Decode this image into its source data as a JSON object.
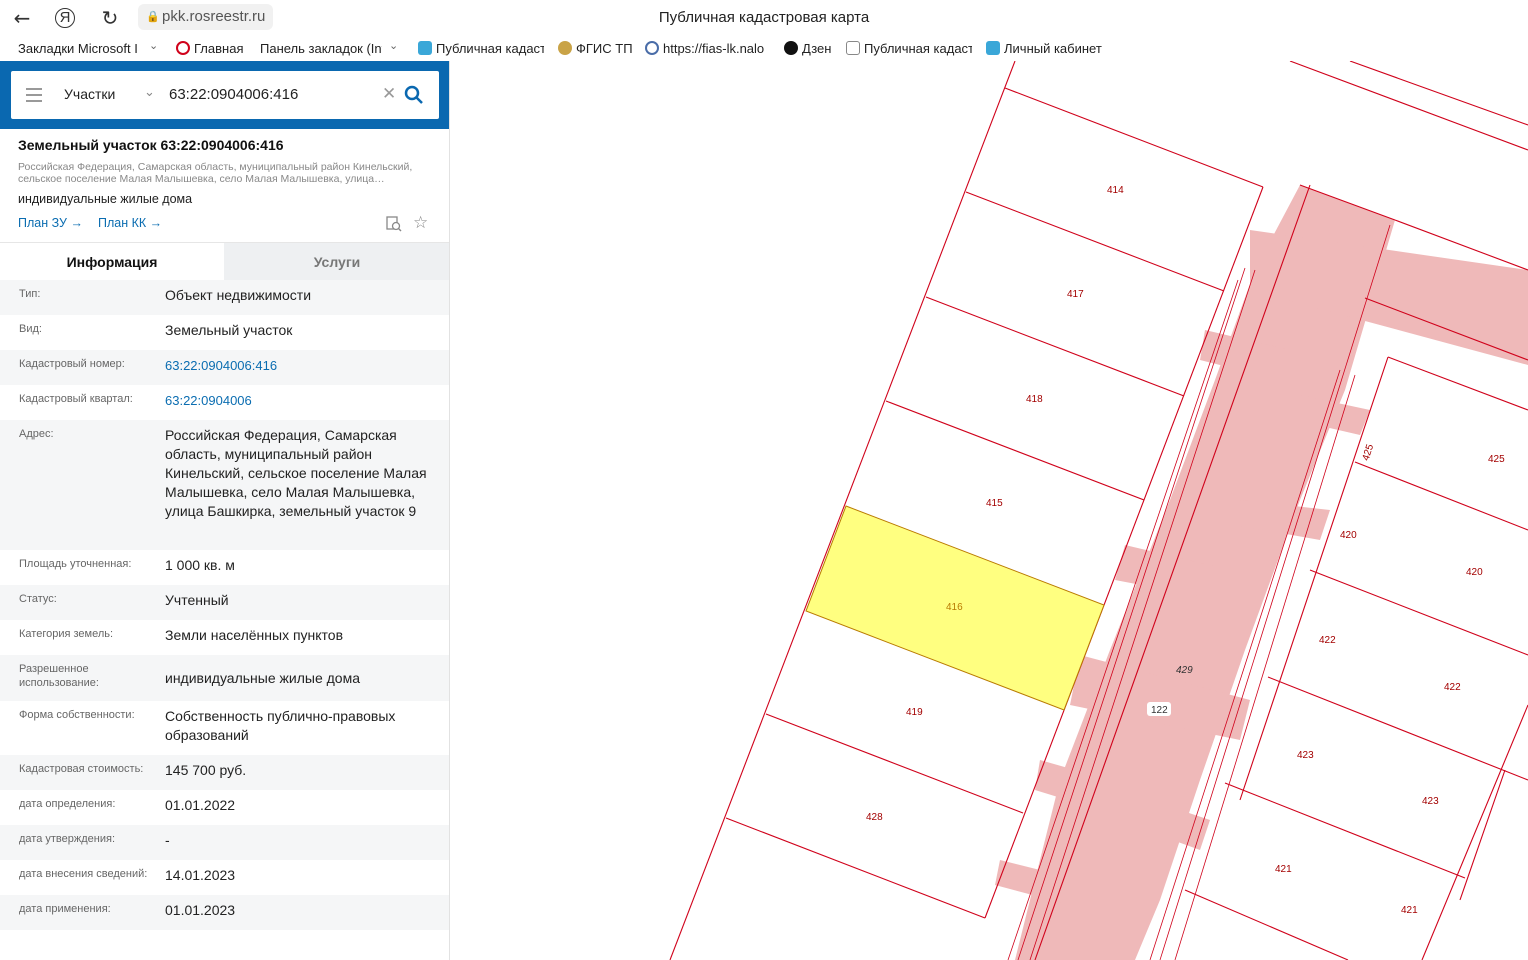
{
  "browser": {
    "url": "pkk.rosreestr.ru",
    "title": "Публичная кадастровая карта"
  },
  "bookmarks": [
    "Закладки Microsoft I",
    "Главная",
    "Панель закладок (Int",
    "Публичная кадаст",
    "ФГИС ТП",
    "https://fias-lk.nalo",
    "Дзен",
    "Публичная кадаст",
    "Личный кабинет"
  ],
  "search": {
    "type": "Участки",
    "query": "63:22:0904006:416"
  },
  "card": {
    "title": "Земельный участок 63:22:0904006:416",
    "addr1": "Российская Федерация, Самарская область, муниципальный район Кинельский,",
    "addr2": "сельское поселение Малая Малышевка, село Малая Малышевка, улица…",
    "usage": "индивидуальные жилые дома",
    "plan_zu": "План ЗУ",
    "plan_kk": "План КК"
  },
  "tabs": {
    "info": "Информация",
    "services": "Услуги"
  },
  "fields": [
    {
      "key": "Тип:",
      "value": "Объект недвижимости"
    },
    {
      "key": "Вид:",
      "value": "Земельный участок"
    },
    {
      "key": "Кадастровый номер:",
      "value": "63:22:0904006:416"
    },
    {
      "key": "Кадастровый квартал:",
      "value": "63:22:0904006"
    },
    {
      "key": "Адрес:",
      "value": "Российская Федерация, Самарская область, муниципальный район Кинельский, сельское поселение Малая Малышевка, село Малая Малышевка, улица Башкирка, земельный участок 9"
    },
    {
      "key": "Площадь уточненная:",
      "value": "1 000 кв. м"
    },
    {
      "key": "Статус:",
      "value": "Учтенный"
    },
    {
      "key": "Категория земель:",
      "value": "Земли населённых пунктов"
    },
    {
      "key": "Разрешенное использование:",
      "value": "индивидуальные жилые дома"
    },
    {
      "key": "Форма собственности:",
      "value": "Собственность публично-правовых образований"
    },
    {
      "key": "Кадастровая стоимость:",
      "value": "145 700 руб."
    },
    {
      "key": "дата определения:",
      "value": "01.01.2022"
    },
    {
      "key": "дата утверждения:",
      "value": "-"
    },
    {
      "key": "дата внесения сведений:",
      "value": "14.01.2023"
    },
    {
      "key": "дата применения:",
      "value": "01.01.2023"
    }
  ],
  "map_labels": {
    "l414": "414",
    "l417": "417",
    "l418": "418",
    "l415": "415",
    "l416": "416",
    "l419": "419",
    "l428": "428",
    "l425a": "425",
    "l425b": "425",
    "l420a": "420",
    "l420b": "420",
    "l422a": "422",
    "l422b": "422",
    "l423a": "423",
    "l423b": "423",
    "l421a": "421",
    "l421b": "421",
    "l429": "429",
    "l122": "122"
  },
  "colors": {
    "accent": "#0a68b0",
    "parcel_line": "#d0021b",
    "selected_fill": "#ffff80",
    "road_fill": "#efb9b9"
  }
}
